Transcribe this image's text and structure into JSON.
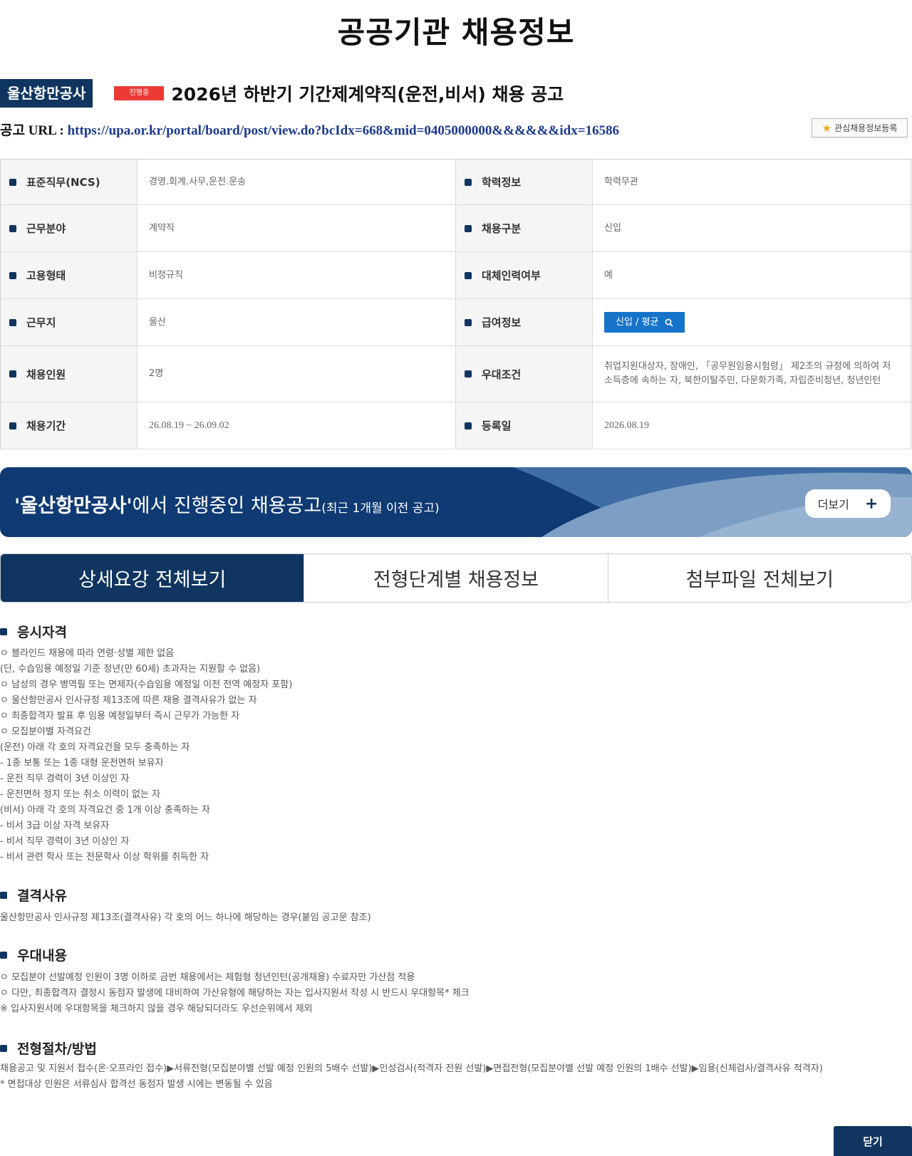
{
  "page_title": "공공기관 채용정보",
  "header": {
    "org_name": "울산항만공사",
    "status": "진행중",
    "notice_title": "2026년 하반기 기간제계약직(운전,비서) 채용 공고"
  },
  "url_row": {
    "label": "공고 URL : ",
    "url": "https://upa.or.kr/portal/board/post/view.do?bcIdx=668&mid=0405000000&&&&&&idx=16586"
  },
  "favorite_button": {
    "label": "관심채용정보등록",
    "icon": "star-icon"
  },
  "info_rows": [
    {
      "h1": "표준직무(NCS)",
      "v1": "경영.회계.사무,운전.운송",
      "h2": "학력정보",
      "v2": "학력무관"
    },
    {
      "h1": "근무분야",
      "v1": "계약직",
      "h2": "채용구분",
      "v2": "신입"
    },
    {
      "h1": "고용형태",
      "v1": "비정규직",
      "h2": "대체인력여부",
      "v2": "예"
    },
    {
      "h1": "근무지",
      "v1": "울산",
      "h2": "급여정보",
      "v2": "신입 / 평균"
    },
    {
      "h1": "채용인원",
      "v1": "2명",
      "h2": "우대조건",
      "v2": "취업지원대상자, 장애인, 「공무원임용시험령」 제2조의 규정에 의하여 저소득층에 속하는 자, 북한이탈주민, 다문화가족, 자립준비청년, 청년인턴"
    },
    {
      "h1": "채용기간",
      "v1": "26.08.19 ~ 26.09.02",
      "h2": "등록일",
      "v2": "2026.08.19"
    }
  ],
  "banner": {
    "quote_open": "'",
    "org": "울산항만공사",
    "quote_close": "'",
    "text": "에서 진행중인 채용공고",
    "small": "(최근 1개월 이전 공고)",
    "more_label": "더보기",
    "more_icon": "+"
  },
  "tabs": [
    {
      "label": "상세요강 전체보기",
      "active": true
    },
    {
      "label": "전형단계별 채용정보",
      "active": false
    },
    {
      "label": "첨부파일 전체보기",
      "active": false
    }
  ],
  "sections": {
    "qualification": {
      "title": "응시자격",
      "lines": [
        "ㅇ 블라인드 채용에 따라 연령·성별 제한 없음",
        "(단, 수습임용 예정일 기준 정년(만 60세) 초과자는 지원할 수 없음)",
        "ㅇ 남성의 경우 병역필 또는 면제자(수습임용 예정일 이전 전역 예정자 포함)",
        "ㅇ 울산항만공사 인사규정 제13조에 따른 채용 결격사유가 없는 자",
        "ㅇ 최종합격자 발표 후 임용 예정일부터 즉시 근무가 가능한 자",
        "ㅇ 모집분야별 자격요건",
        "(운전) 아래 각 호의 자격요건을 모두 충족하는 자",
        "- 1종 보통 또는 1종 대형 운전면허 보유자",
        "- 운전 직무 경력이 3년 이상인 자",
        "- 운전면허 정지 또는 취소 이력이 없는 자",
        "(비서) 아래 각 호의 자격요건 중 1개 이상 충족하는 자",
        "- 비서 3급 이상 자격 보유자",
        "- 비서 직무 경력이 3년 이상인 자",
        "- 비서 관련 학사 또는 전문학사 이상 학위를 취득한 자"
      ]
    },
    "disqualification": {
      "title": "결격사유",
      "lines": [
        "울산항만공사 인사규정 제13조(결격사유) 각 호의 어느 하나에 해당하는 경우(붙임 공고문 참조)"
      ]
    },
    "preference": {
      "title": "우대내용",
      "lines": [
        "ㅇ 모집분야 선발예정 인원이 3명 이하로 금번 채용에서는 체험형 청년인턴(공개채용) 수료자만 가산점 적용",
        "ㅇ 다만, 최종합격자 결정시 동점자 발생에 대비하여 가산유형에 해당하는 자는 입사지원서 작성 시 반드시 우대항목* 체크",
        "※ 입사지원서에 우대항목을 체크하지 않을 경우 해당되더라도 우선순위에서 제외"
      ]
    },
    "procedure": {
      "title": "전형절차/방법",
      "lines": [
        "채용공고 및 지원서 접수(온·오프라인 접수)▶서류전형(모집분야별 선발 예정 인원의 5배수 선발)▶인성검사(적격자 전원 선발)▶면접전형(모집분야별 선발 예정 인원의 1배수 선발)▶임용(신체검사/결격사유 적격자)",
        "* 면접대상 인원은 서류심사 합격선 동점자 발생 시에는 변동될 수 있음"
      ]
    }
  },
  "close_button": "닫기",
  "colors": {
    "navy": "#0f3560",
    "status_red": "#ec3b35",
    "salary_blue": "#1574c9",
    "banner_blue": "#0f3a73"
  }
}
